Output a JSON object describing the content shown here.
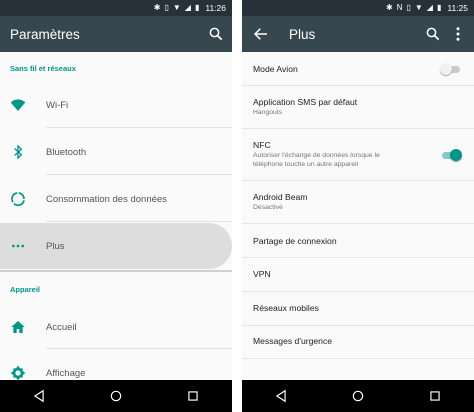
{
  "left_screen": {
    "status_time": "11:26",
    "title": "Paramètres",
    "section_wireless": "Sans fil et réseaux",
    "items": [
      {
        "label": "Wi-Fi",
        "icon": "wifi-icon"
      },
      {
        "label": "Bluetooth",
        "icon": "bluetooth-icon"
      },
      {
        "label": "Consommation des données",
        "icon": "data-usage-icon"
      },
      {
        "label": "Plus",
        "icon": "more-dots-icon"
      }
    ],
    "section_device": "Appareil",
    "device_items": [
      {
        "label": "Accueil",
        "icon": "home-icon"
      },
      {
        "label": "Affichage",
        "icon": "brightness-icon"
      }
    ]
  },
  "right_screen": {
    "status_time": "11:25",
    "title": "Plus",
    "items": [
      {
        "title": "Mode Avion",
        "subtitle": "",
        "toggle": "off"
      },
      {
        "title": "Application SMS par défaut",
        "subtitle": "Hangouts"
      },
      {
        "title": "NFC",
        "subtitle": "Autoriser l'échange de données lorsque le téléphone touche un autre appareil",
        "toggle": "on"
      },
      {
        "title": "Android Beam",
        "subtitle": "Désactivé"
      },
      {
        "title": "Partage de connexion",
        "subtitle": ""
      },
      {
        "title": "VPN",
        "subtitle": ""
      },
      {
        "title": "Réseaux mobiles",
        "subtitle": ""
      },
      {
        "title": "Messages d'urgence",
        "subtitle": ""
      }
    ]
  },
  "colors": {
    "accent": "#009688",
    "toolbar": "#37474f",
    "statusbar": "#263238",
    "navbar": "#000000"
  }
}
